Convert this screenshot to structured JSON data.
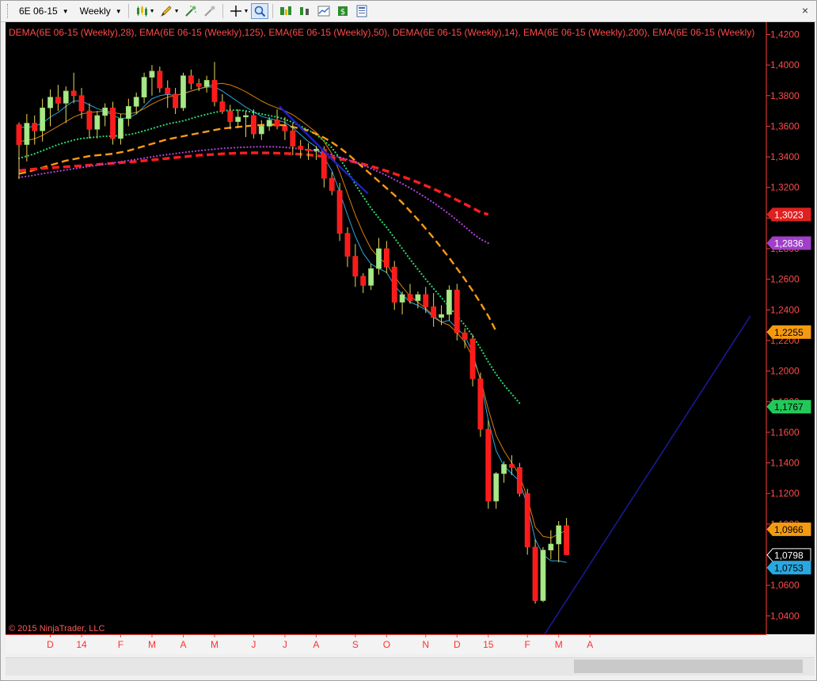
{
  "toolbar": {
    "instrument": "6E 06-15",
    "interval": "Weekly",
    "close_glyph": "×"
  },
  "chart_data": {
    "type": "candlestick",
    "title": "DEMA(6E 06-15 (Weekly),28), EMA(6E 06-15 (Weekly),125), EMA(6E 06-15 (Weekly),50), DEMA(6E 06-15 (Weekly),14), EMA(6E 06-15 (Weekly),200), EMA(6E 06-15 (Weekly)",
    "watermark": "© 2015 NinjaTrader, LLC",
    "ylim": [
      1.028,
      1.428
    ],
    "y_ticks": [
      1.04,
      1.06,
      1.08,
      1.1,
      1.12,
      1.14,
      1.16,
      1.18,
      1.2,
      1.22,
      1.24,
      1.26,
      1.28,
      1.3,
      1.32,
      1.34,
      1.36,
      1.38,
      1.4,
      1.42
    ],
    "y_tick_labels": [
      "1,0400",
      "1,0600",
      "1,0800",
      "1,1000",
      "1,1200",
      "1,1400",
      "1,1600",
      "1,1800",
      "1,2000",
      "1,2200",
      "1,2400",
      "1,2600",
      "1,2800",
      "1,3000",
      "1,3200",
      "1,3400",
      "1,3600",
      "1,3800",
      "1,4000",
      "1,4200"
    ],
    "x_labels": [
      {
        "label": "D",
        "bar": 4
      },
      {
        "label": "14",
        "bar": 8
      },
      {
        "label": "F",
        "bar": 13
      },
      {
        "label": "M",
        "bar": 17
      },
      {
        "label": "A",
        "bar": 21
      },
      {
        "label": "M",
        "bar": 25
      },
      {
        "label": "J",
        "bar": 30
      },
      {
        "label": "J",
        "bar": 34
      },
      {
        "label": "A",
        "bar": 38
      },
      {
        "label": "S",
        "bar": 43
      },
      {
        "label": "O",
        "bar": 47
      },
      {
        "label": "N",
        "bar": 52
      },
      {
        "label": "D",
        "bar": 56
      },
      {
        "label": "15",
        "bar": 60
      },
      {
        "label": "F",
        "bar": 65
      },
      {
        "label": "M",
        "bar": 69
      },
      {
        "label": "A",
        "bar": 73
      }
    ],
    "candles": [
      [
        1.361,
        1.3625,
        1.3255,
        1.348
      ],
      [
        1.348,
        1.368,
        1.337,
        1.362
      ],
      [
        1.362,
        1.367,
        1.348,
        1.357
      ],
      [
        1.357,
        1.378,
        1.35,
        1.372
      ],
      [
        1.372,
        1.384,
        1.36,
        1.379
      ],
      [
        1.379,
        1.387,
        1.37,
        1.375
      ],
      [
        1.375,
        1.386,
        1.362,
        1.383
      ],
      [
        1.383,
        1.395,
        1.375,
        1.38
      ],
      [
        1.38,
        1.385,
        1.365,
        1.37
      ],
      [
        1.37,
        1.375,
        1.352,
        1.358
      ],
      [
        1.358,
        1.37,
        1.352,
        1.367
      ],
      [
        1.367,
        1.375,
        1.36,
        1.372
      ],
      [
        1.372,
        1.376,
        1.348,
        1.352
      ],
      [
        1.352,
        1.368,
        1.348,
        1.365
      ],
      [
        1.365,
        1.378,
        1.36,
        1.373
      ],
      [
        1.373,
        1.382,
        1.368,
        1.379
      ],
      [
        1.379,
        1.395,
        1.375,
        1.392
      ],
      [
        1.392,
        1.4,
        1.38,
        1.396
      ],
      [
        1.396,
        1.399,
        1.382,
        1.385
      ],
      [
        1.385,
        1.39,
        1.372,
        1.381
      ],
      [
        1.381,
        1.385,
        1.368,
        1.372
      ],
      [
        1.372,
        1.395,
        1.37,
        1.393
      ],
      [
        1.393,
        1.397,
        1.384,
        1.388
      ],
      [
        1.388,
        1.391,
        1.383,
        1.386
      ],
      [
        1.386,
        1.393,
        1.382,
        1.39
      ],
      [
        1.39,
        1.402,
        1.373,
        1.376
      ],
      [
        1.376,
        1.381,
        1.368,
        1.37
      ],
      [
        1.37,
        1.374,
        1.358,
        1.363
      ],
      [
        1.363,
        1.371,
        1.359,
        1.366
      ],
      [
        1.366,
        1.37,
        1.353,
        1.367
      ],
      [
        1.367,
        1.371,
        1.352,
        1.355
      ],
      [
        1.355,
        1.364,
        1.351,
        1.36
      ],
      [
        1.36,
        1.366,
        1.357,
        1.364
      ],
      [
        1.364,
        1.371,
        1.358,
        1.36
      ],
      [
        1.36,
        1.366,
        1.351,
        1.357
      ],
      [
        1.357,
        1.362,
        1.341,
        1.347
      ],
      [
        1.347,
        1.351,
        1.339,
        1.345
      ],
      [
        1.345,
        1.349,
        1.338,
        1.344
      ],
      [
        1.344,
        1.347,
        1.338,
        1.345
      ],
      [
        1.345,
        1.347,
        1.32,
        1.326
      ],
      [
        1.326,
        1.33,
        1.315,
        1.318
      ],
      [
        1.318,
        1.323,
        1.285,
        1.29
      ],
      [
        1.29,
        1.294,
        1.268,
        1.275
      ],
      [
        1.275,
        1.283,
        1.255,
        1.262
      ],
      [
        1.262,
        1.264,
        1.251,
        1.256
      ],
      [
        1.256,
        1.27,
        1.253,
        1.267
      ],
      [
        1.267,
        1.287,
        1.263,
        1.28
      ],
      [
        1.28,
        1.285,
        1.264,
        1.268
      ],
      [
        1.268,
        1.272,
        1.24,
        1.245
      ],
      [
        1.245,
        1.252,
        1.237,
        1.25
      ],
      [
        1.25,
        1.257,
        1.244,
        1.246
      ],
      [
        1.246,
        1.252,
        1.241,
        1.25
      ],
      [
        1.25,
        1.255,
        1.238,
        1.242
      ],
      [
        1.242,
        1.251,
        1.229,
        1.235
      ],
      [
        1.235,
        1.243,
        1.23,
        1.237
      ],
      [
        1.237,
        1.256,
        1.233,
        1.253
      ],
      [
        1.253,
        1.257,
        1.22,
        1.225
      ],
      [
        1.225,
        1.228,
        1.215,
        1.221
      ],
      [
        1.221,
        1.224,
        1.19,
        1.195
      ],
      [
        1.195,
        1.199,
        1.157,
        1.162
      ],
      [
        1.162,
        1.168,
        1.11,
        1.115
      ],
      [
        1.115,
        1.134,
        1.11,
        1.133
      ],
      [
        1.133,
        1.141,
        1.127,
        1.139
      ],
      [
        1.139,
        1.145,
        1.132,
        1.137
      ],
      [
        1.137,
        1.14,
        1.118,
        1.12
      ],
      [
        1.12,
        1.123,
        1.08,
        1.085
      ],
      [
        1.085,
        1.09,
        1.048,
        1.05
      ],
      [
        1.05,
        1.085,
        1.049,
        1.083
      ],
      [
        1.083,
        1.096,
        1.077,
        1.087
      ],
      [
        1.087,
        1.102,
        1.075,
        1.099
      ],
      [
        1.099,
        1.104,
        1.08,
        1.08
      ]
    ],
    "series": [
      {
        "color": "#29a8e0",
        "style": "thin",
        "values": [
          1.3595,
          1.3592,
          1.36,
          1.362,
          1.366,
          1.369,
          1.373,
          1.3765,
          1.3765,
          1.374,
          1.3715,
          1.37,
          1.367,
          1.365,
          1.3655,
          1.368,
          1.373,
          1.378,
          1.38,
          1.3808,
          1.38,
          1.3812,
          1.383,
          1.3845,
          1.3855,
          1.3858,
          1.383,
          1.3795,
          1.376,
          1.3725,
          1.3695,
          1.3665,
          1.365,
          1.364,
          1.3625,
          1.359,
          1.3545,
          1.35,
          1.3465,
          1.3395,
          1.331,
          1.317,
          1.302,
          1.288,
          1.277,
          1.27,
          1.267,
          1.2645,
          1.256,
          1.25,
          1.245,
          1.243,
          1.24,
          1.235,
          1.232,
          1.233,
          1.228,
          1.223,
          1.212,
          1.194,
          1.168,
          1.148,
          1.138,
          1.133,
          1.128,
          1.112,
          1.09,
          1.08,
          1.076,
          1.076,
          1.075
        ]
      },
      {
        "color": "#d9800a",
        "style": "thin",
        "values": [
          1.35,
          1.3508,
          1.3518,
          1.354,
          1.357,
          1.36,
          1.363,
          1.366,
          1.368,
          1.369,
          1.3695,
          1.37,
          1.369,
          1.368,
          1.368,
          1.369,
          1.3715,
          1.3745,
          1.377,
          1.379,
          1.38,
          1.3815,
          1.383,
          1.3845,
          1.386,
          1.3875,
          1.388,
          1.387,
          1.385,
          1.3825,
          1.3795,
          1.3765,
          1.374,
          1.372,
          1.37,
          1.3675,
          1.364,
          1.36,
          1.356,
          1.35,
          1.342,
          1.33,
          1.316,
          1.302,
          1.29,
          1.28,
          1.274,
          1.27,
          1.262,
          1.255,
          1.249,
          1.245,
          1.241,
          1.236,
          1.232,
          1.23,
          1.225,
          1.219,
          1.209,
          1.195,
          1.175,
          1.158,
          1.148,
          1.14,
          1.132,
          1.117,
          1.098,
          1.092,
          1.091,
          1.0935,
          1.096
        ]
      },
      {
        "color": "#2ad46a",
        "style": "dots",
        "width": 2.2,
        "values": [
          1.339,
          1.3405,
          1.342,
          1.344,
          1.346,
          1.348,
          1.3495,
          1.351,
          1.352,
          1.3525,
          1.353,
          1.3535,
          1.3535,
          1.354,
          1.3545,
          1.3555,
          1.357,
          1.3585,
          1.36,
          1.3615,
          1.3625,
          1.3635,
          1.365,
          1.3665,
          1.3678,
          1.369,
          1.37,
          1.3705,
          1.3705,
          1.37,
          1.369,
          1.368,
          1.367,
          1.366,
          1.3645,
          1.3625,
          1.36,
          1.3575,
          1.3545,
          1.3505,
          1.346,
          1.339,
          1.331,
          1.322,
          1.314,
          1.3065,
          1.3,
          1.294,
          1.287,
          1.28,
          1.273,
          1.2665,
          1.26,
          1.254,
          1.248,
          1.242,
          1.236,
          1.23,
          1.223,
          1.215,
          1.206,
          1.198,
          1.191,
          1.185,
          1.179
        ]
      },
      {
        "color": "#ff9a14",
        "style": "dash",
        "width": 2.4,
        "values": [
          1.329,
          1.33,
          1.3315,
          1.333,
          1.3345,
          1.336,
          1.3375,
          1.3385,
          1.3395,
          1.3405,
          1.341,
          1.3415,
          1.342,
          1.343,
          1.344,
          1.3455,
          1.347,
          1.3485,
          1.35,
          1.3515,
          1.3525,
          1.3535,
          1.3545,
          1.3555,
          1.3565,
          1.3575,
          1.3585,
          1.359,
          1.3595,
          1.36,
          1.3605,
          1.3608,
          1.361,
          1.361,
          1.3605,
          1.3595,
          1.3585,
          1.357,
          1.355,
          1.3525,
          1.3495,
          1.346,
          1.342,
          1.3375,
          1.333,
          1.3285,
          1.324,
          1.3195,
          1.315,
          1.31,
          1.3045,
          1.299,
          1.293,
          1.287,
          1.2805,
          1.274,
          1.267,
          1.26,
          1.2525,
          1.2445,
          1.236,
          1.226
        ]
      },
      {
        "color": "#ff1e1e",
        "style": "dash",
        "width": 3.4,
        "values": [
          1.331,
          1.3315,
          1.332,
          1.3325,
          1.3328,
          1.3332,
          1.3335,
          1.3338,
          1.3342,
          1.3346,
          1.335,
          1.3354,
          1.3358,
          1.3362,
          1.3366,
          1.337,
          1.3375,
          1.338,
          1.3385,
          1.339,
          1.3395,
          1.34,
          1.3405,
          1.341,
          1.3413,
          1.3416,
          1.342,
          1.3422,
          1.3424,
          1.3425,
          1.3426,
          1.3426,
          1.3425,
          1.3424,
          1.3422,
          1.342,
          1.3417,
          1.3413,
          1.3408,
          1.3402,
          1.3395,
          1.3387,
          1.3377,
          1.3365,
          1.3352,
          1.3338,
          1.3323,
          1.3307,
          1.329,
          1.3272,
          1.3253,
          1.3233,
          1.3212,
          1.319,
          1.3167,
          1.3143,
          1.3118,
          1.3092,
          1.3065,
          1.3038,
          1.3023
        ]
      },
      {
        "color": "#b142d6",
        "style": "dots",
        "width": 2.2,
        "values": [
          1.3265,
          1.3272,
          1.328,
          1.329,
          1.3298,
          1.3306,
          1.3315,
          1.3322,
          1.333,
          1.3338,
          1.3345,
          1.3352,
          1.336,
          1.3368,
          1.3376,
          1.3384,
          1.3392,
          1.34,
          1.3408,
          1.3415,
          1.3422,
          1.3428,
          1.3434,
          1.344,
          1.3445,
          1.345,
          1.3455,
          1.3458,
          1.3461,
          1.3463,
          1.3465,
          1.3466,
          1.3466,
          1.3465,
          1.3462,
          1.3458,
          1.3452,
          1.3445,
          1.3436,
          1.3425,
          1.3412,
          1.3398,
          1.3382,
          1.3364,
          1.3345,
          1.3324,
          1.3302,
          1.3278,
          1.3252,
          1.3225,
          1.3196,
          1.3166,
          1.3134,
          1.31,
          1.3064,
          1.3026,
          1.2986,
          1.2944,
          1.29,
          1.2862,
          1.2836
        ]
      }
    ],
    "price_markers": [
      {
        "label": "1,3023",
        "value": 1.3023,
        "bg": "#e02020",
        "fg": "#ffffff"
      },
      {
        "label": "1,2836",
        "value": 1.2836,
        "bg": "#a040c8",
        "fg": "#ffffff"
      },
      {
        "label": "1,2255",
        "value": 1.2255,
        "bg": "#f59a10",
        "fg": "#000000"
      },
      {
        "label": "1,1767",
        "value": 1.1767,
        "bg": "#22c85a",
        "fg": "#000000"
      },
      {
        "label": "1,0966",
        "value": 1.0966,
        "bg": "#f59a10",
        "fg": "#000000"
      },
      {
        "label": "1,0798",
        "value": 1.0798,
        "bg": "#000000",
        "fg": "#ffffff"
      },
      {
        "label": "1,0753",
        "value": 1.0753,
        "bg": "#29a8e0",
        "fg": "#000000"
      }
    ],
    "trendlines": [
      {
        "color": "#1a22c8",
        "width": 2.4,
        "from": [
          33.3,
          1.373
        ],
        "to": [
          40.3,
          1.337
        ]
      },
      {
        "color": "#1a22c8",
        "width": 2.4,
        "from": [
          40.3,
          1.337
        ],
        "to": [
          44.6,
          1.316
        ]
      },
      {
        "color": "#1c1ca6",
        "width": 1.4,
        "from": [
          67.2,
          1.028
        ],
        "to": [
          93.5,
          1.236
        ]
      }
    ]
  }
}
